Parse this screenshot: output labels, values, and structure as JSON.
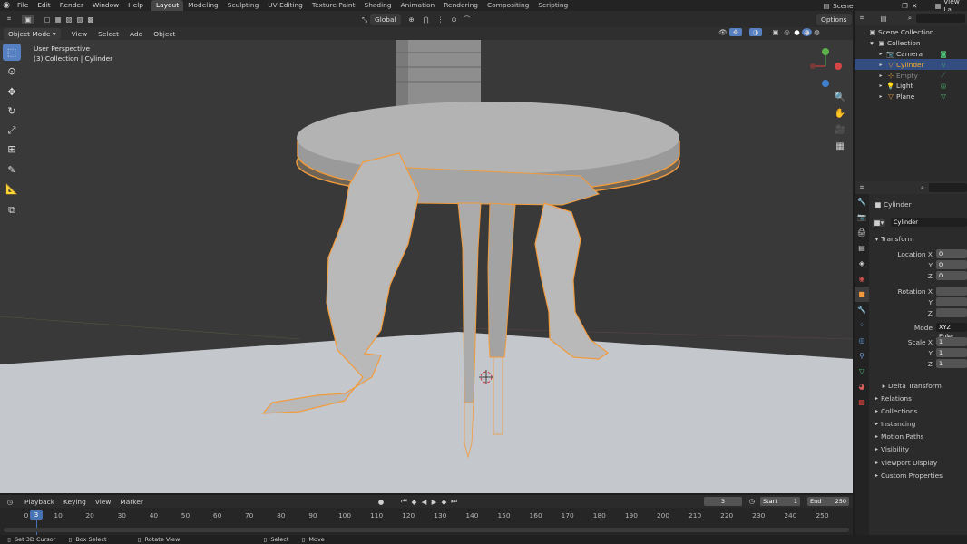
{
  "menus": [
    "File",
    "Edit",
    "Render",
    "Window",
    "Help"
  ],
  "workspace_tabs": [
    "Layout",
    "Modeling",
    "Sculpting",
    "UV Editing",
    "Texture Paint",
    "Shading",
    "Animation",
    "Rendering",
    "Compositing",
    "Scripting"
  ],
  "active_workspace": "Layout",
  "scene_label": "Scene",
  "view_layer_label": "View La",
  "header": {
    "transform_orientation": "Global",
    "options_label": "Options"
  },
  "mode_bar": {
    "mode": "Object Mode",
    "items": [
      "View",
      "Select",
      "Add",
      "Object"
    ]
  },
  "viewport": {
    "perspective": "User Perspective",
    "context": "(3) Collection | Cylinder"
  },
  "outliner": {
    "root": "Scene Collection",
    "collection": "Collection",
    "items": [
      {
        "label": "Camera",
        "icon": "camera-icon",
        "selected": false,
        "color": "#d7d7d7"
      },
      {
        "label": "Cylinder",
        "icon": "mesh-icon",
        "selected": true,
        "color": "#ffaf29"
      },
      {
        "label": "Empty",
        "icon": "empty-icon",
        "selected": false,
        "color": "#8a8a8a"
      },
      {
        "label": "Light",
        "icon": "light-icon",
        "selected": false,
        "color": "#d7d7d7"
      },
      {
        "label": "Plane",
        "icon": "mesh-icon",
        "selected": false,
        "color": "#d7d7d7"
      }
    ]
  },
  "properties": {
    "object_name": "Cylinder",
    "data_name": "Cylinder",
    "transform_label": "Transform",
    "location_label": "Location X",
    "rotation_label": "Rotation X",
    "scale_label": "Scale X",
    "y_label": "Y",
    "z_label": "Z",
    "location": [
      "0",
      "0",
      "0"
    ],
    "rotation": [
      "",
      "",
      ""
    ],
    "scale": [
      "1",
      "1",
      "1"
    ],
    "mode_label": "Mode",
    "mode_value": "XYZ Euler",
    "delta_label": "Delta Transform",
    "sections": [
      "Relations",
      "Collections",
      "Instancing",
      "Motion Paths",
      "Visibility",
      "Viewport Display",
      "Custom Properties"
    ]
  },
  "timeline": {
    "menus": [
      "Playback",
      "Keying",
      "View",
      "Marker"
    ],
    "current_frame": "3",
    "start_label": "Start",
    "start": "1",
    "end_label": "End",
    "end": "250",
    "ticks": [
      "0",
      "10",
      "20",
      "30",
      "40",
      "50",
      "60",
      "70",
      "80",
      "90",
      "100",
      "110",
      "120",
      "130",
      "140",
      "150",
      "160",
      "170",
      "180",
      "190",
      "200",
      "210",
      "220",
      "230",
      "240",
      "250"
    ],
    "cursor_label": "3"
  },
  "status": [
    "Set 3D Cursor",
    "Box Select",
    "Rotate View",
    "Select",
    "Move"
  ],
  "colors": {
    "accent": "#5680c2",
    "selection": "#ffaf29",
    "outline": "#f29b3c"
  }
}
